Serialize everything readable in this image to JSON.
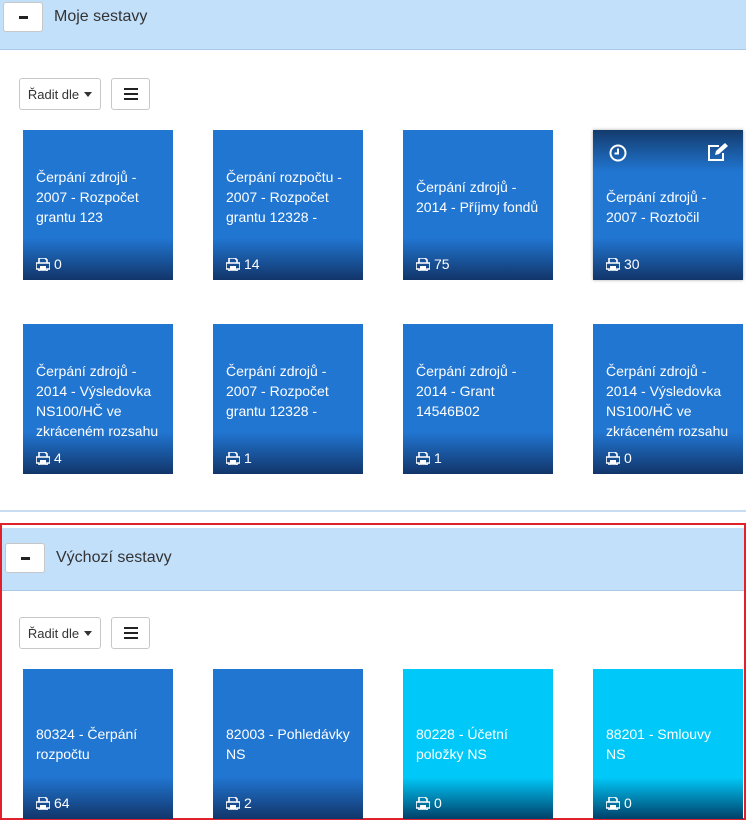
{
  "my_reports": {
    "title": "Moje sestavy",
    "sort_label": "Řadit dle",
    "tiles": [
      {
        "title": "Čerpání zdrojů -\n2007 - Rozpočet\ngrantu 123",
        "count": "0"
      },
      {
        "title": "Čerpání rozpočtu -\n2007 - Rozpočet\ngrantu 12328 -",
        "count": "14"
      },
      {
        "title": "Čerpání zdrojů -\n2014 - Příjmy fondů",
        "count": "75"
      },
      {
        "title": "Čerpání zdrojů -\n2007 - Roztočil",
        "count": "30"
      },
      {
        "title": "Čerpání zdrojů -\n2014 - Výsledovka\nNS100/HČ ve\nzkráceném rozsahu",
        "count": "4"
      },
      {
        "title": "Čerpání zdrojů -\n2007 - Rozpočet\ngrantu 12328 -",
        "count": "1"
      },
      {
        "title": "Čerpání zdrojů -\n2014 - Grant\n14546B02",
        "count": "1"
      },
      {
        "title": "Čerpání zdrojů -\n2014 - Výsledovka\nNS100/HČ ve\nzkráceném rozsahu",
        "count": "0"
      }
    ]
  },
  "default_reports": {
    "title": "Výchozí sestavy",
    "sort_label": "Řadit dle",
    "tiles": [
      {
        "title": "80324 - Čerpání\nrozpočtu",
        "count": "64"
      },
      {
        "title": "82003 - Pohledávky\nNS",
        "count": "2"
      },
      {
        "title": "80228 - Účetní\npoložky NS",
        "count": "0"
      },
      {
        "title": "88201 - Smlouvy\nNS",
        "count": "0"
      }
    ]
  },
  "colors": {
    "tile_blue": "#2176d2",
    "tile_cyan": "#00c9f9",
    "header_bg": "#c3e0fb",
    "highlight_border": "#e0202a"
  },
  "icons": {
    "count": "print-icon",
    "history": "clock-icon",
    "edit": "edit-icon",
    "view": "list-icon",
    "collapse": "minus-icon"
  }
}
